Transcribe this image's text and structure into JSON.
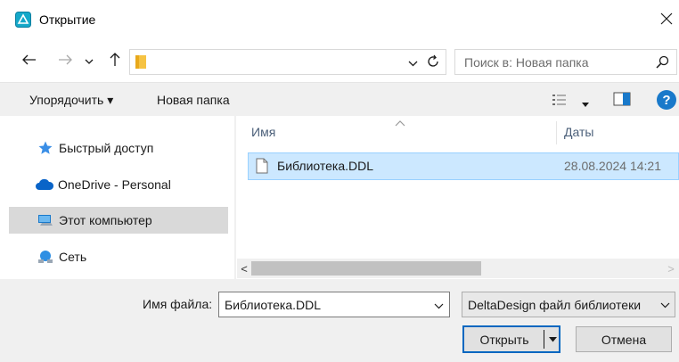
{
  "window": {
    "title": "Открытие",
    "icon": "deltadesign-app-icon",
    "close_glyph": "✕"
  },
  "navigation": {
    "back_glyph": "←",
    "forward_glyph": "→",
    "recent_glyph": "⌄",
    "up_glyph": "↑",
    "address_value": "",
    "search_placeholder": "Поиск в: Новая папка"
  },
  "toolbar": {
    "organize_label": "Упорядочить ▾",
    "new_folder_label": "Новая папка",
    "help_glyph": "?"
  },
  "sidebar": {
    "items": [
      {
        "label": "Быстрый доступ",
        "icon": "star-icon",
        "selected": false
      },
      {
        "label": "OneDrive - Personal",
        "icon": "cloud-icon",
        "selected": false
      },
      {
        "label": "Этот компьютер",
        "icon": "computer-icon",
        "selected": true
      },
      {
        "label": "Сеть",
        "icon": "network-icon",
        "selected": false
      }
    ]
  },
  "filelist": {
    "columns": {
      "name": "Имя",
      "date": "Даты"
    },
    "files": [
      {
        "name": "Библиотека.DDL",
        "date": "28.08.2024 14:21",
        "selected": true
      }
    ],
    "scroll_left_glyph": "<",
    "scroll_right_glyph": ">"
  },
  "footer": {
    "filename_label": "Имя файла:",
    "filename_value": "Библиотека.DDL",
    "filetype_value": "DeltaDesign файл библиотеки",
    "open_label": "Открыть",
    "cancel_label": "Отмена"
  },
  "colors": {
    "accent": "#0067c0",
    "selection": "#cce8ff",
    "selection_border": "#99d1ff",
    "nav_selected": "#d9d9d9",
    "help_blue": "#1979ca"
  }
}
